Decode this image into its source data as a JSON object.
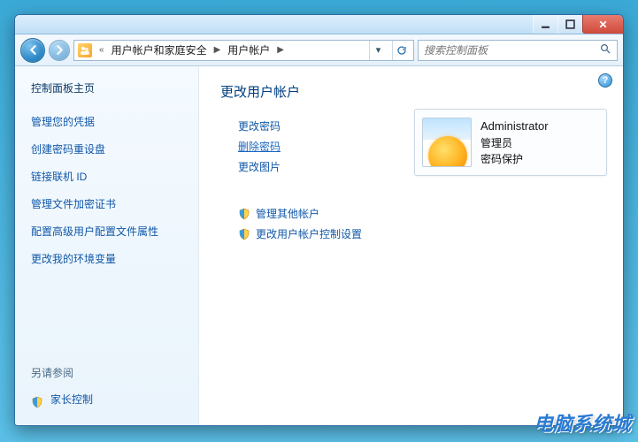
{
  "titlebar": {},
  "address": {
    "chevron_prefix": "«",
    "segment1": "用户帐户和家庭安全",
    "segment2": "用户帐户"
  },
  "search": {
    "placeholder": "搜索控制面板"
  },
  "sidebar": {
    "heading": "控制面板主页",
    "links": [
      "管理您的凭据",
      "创建密码重设盘",
      "链接联机 ID",
      "管理文件加密证书",
      "配置高级用户配置文件属性",
      "更改我的环境变量"
    ],
    "seealso_title": "另请参阅",
    "seealso_links": [
      "家长控制"
    ]
  },
  "content": {
    "heading": "更改用户帐户",
    "actions": [
      "更改密码",
      "删除密码",
      "更改图片"
    ],
    "admin_actions": [
      "管理其他帐户",
      "更改用户帐户控制设置"
    ]
  },
  "user_card": {
    "name": "Administrator",
    "role": "管理员",
    "protection": "密码保护"
  },
  "watermark": {
    "text": "电脑系统城"
  }
}
